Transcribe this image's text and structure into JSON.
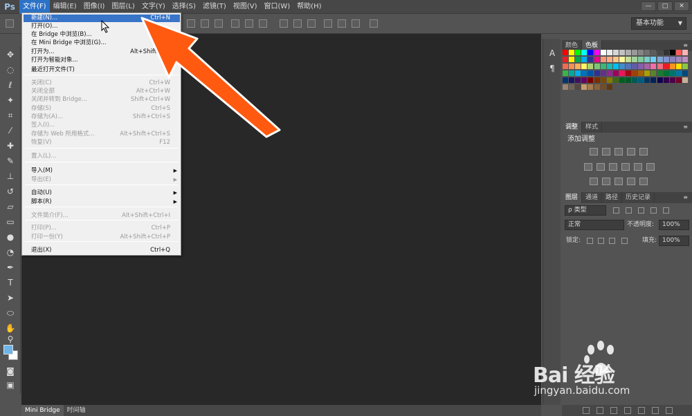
{
  "app": {
    "logo": "Ps"
  },
  "menubar": {
    "items": [
      "文件(F)",
      "编辑(E)",
      "图像(I)",
      "图层(L)",
      "文字(Y)",
      "选择(S)",
      "滤镜(T)",
      "视图(V)",
      "窗口(W)",
      "帮助(H)"
    ],
    "active_index": 0
  },
  "window_buttons": [
    "—",
    "□",
    "✕"
  ],
  "options": {
    "workspace": "基本功能"
  },
  "file_menu": {
    "items": [
      {
        "label": "新建(N)...",
        "shortcut": "Ctrl+N",
        "highlighted": true
      },
      {
        "label": "打开(O)...",
        "shortcut": ""
      },
      {
        "label": "在 Bridge 中浏览(B)...",
        "shortcut": "Alt+"
      },
      {
        "label": "在 Mini Bridge 中浏览(G)...",
        "shortcut": ""
      },
      {
        "label": "打开为...",
        "shortcut": "Alt+Shift+Ctr"
      },
      {
        "label": "打开为智能对象...",
        "shortcut": ""
      },
      {
        "label": "最近打开文件(T)",
        "shortcut": ""
      },
      {
        "label": "关闭(C)",
        "shortcut": "Ctrl+W",
        "disabled": true
      },
      {
        "label": "关闭全部",
        "shortcut": "Alt+Ctrl+W",
        "disabled": true
      },
      {
        "label": "关闭并转到 Bridge...",
        "shortcut": "Shift+Ctrl+W",
        "disabled": true
      },
      {
        "label": "存储(S)",
        "shortcut": "Ctrl+S",
        "disabled": true
      },
      {
        "label": "存储为(A)...",
        "shortcut": "Shift+Ctrl+S",
        "disabled": true
      },
      {
        "label": "签入(I)...",
        "shortcut": "",
        "disabled": true
      },
      {
        "label": "存储为 Web 所用格式...",
        "shortcut": "Alt+Shift+Ctrl+S",
        "disabled": true
      },
      {
        "label": "恢复(V)",
        "shortcut": "F12",
        "disabled": true
      },
      {
        "label": "置入(L)...",
        "shortcut": "",
        "disabled": true
      },
      {
        "label": "导入(M)",
        "shortcut": "",
        "submenu": true
      },
      {
        "label": "导出(E)",
        "shortcut": "",
        "submenu": true,
        "disabled": true
      },
      {
        "label": "自动(U)",
        "shortcut": "",
        "submenu": true
      },
      {
        "label": "脚本(R)",
        "shortcut": "",
        "submenu": true
      },
      {
        "label": "文件简介(F)...",
        "shortcut": "Alt+Shift+Ctrl+I",
        "disabled": true
      },
      {
        "label": "打印(P)...",
        "shortcut": "Ctrl+P",
        "disabled": true
      },
      {
        "label": "打印一份(Y)",
        "shortcut": "Alt+Shift+Ctrl+P",
        "disabled": true
      },
      {
        "label": "退出(X)",
        "shortcut": "Ctrl+Q"
      }
    ]
  },
  "panels": {
    "color_tabs": [
      "颜色",
      "色板"
    ],
    "adjust_tabs": [
      "调整",
      "样式"
    ],
    "adjust_title": "添加调整",
    "layer_tabs": [
      "图层",
      "通道",
      "路径",
      "历史记录"
    ],
    "filter_kind": "ρ 类型",
    "blend_mode": "正常",
    "opacity_label": "不透明度:",
    "opacity_value": "100%",
    "lock_label": "锁定:",
    "fill_label": "填充:",
    "fill_value": "100%"
  },
  "bottom_tabs": [
    "Mini Bridge",
    "时间轴"
  ],
  "watermark": {
    "brand": "Bai 经验",
    "url": "jingyan.baidu.com"
  },
  "colors": {
    "accent": "#3874c8",
    "arrow": "#ff5a10",
    "foreground": "#6fb4e6",
    "background": "#ffffff"
  }
}
